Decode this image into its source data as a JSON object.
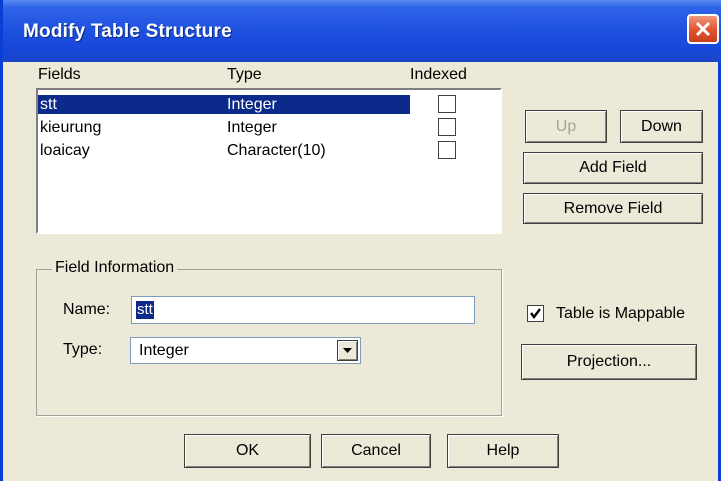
{
  "window": {
    "title": "Modify Table Structure",
    "close_icon": "close-icon"
  },
  "columns": {
    "fields": "Fields",
    "type": "Type",
    "indexed": "Indexed"
  },
  "fields": [
    {
      "name": "stt",
      "type": "Integer",
      "indexed": false,
      "selected": true
    },
    {
      "name": "kieurung",
      "type": "Integer",
      "indexed": false,
      "selected": false
    },
    {
      "name": "loaicay",
      "type": "Character(10)",
      "indexed": false,
      "selected": false
    }
  ],
  "buttons": {
    "up": "Up",
    "down": "Down",
    "add_field": "Add Field",
    "remove_field": "Remove Field",
    "projection": "Projection...",
    "ok": "OK",
    "cancel": "Cancel",
    "help": "Help"
  },
  "field_info": {
    "legend": "Field Information",
    "name_label": "Name:",
    "name_value": "stt",
    "type_label": "Type:",
    "type_value": "Integer"
  },
  "table_mappable": {
    "label": "Table is Mappable",
    "checked": true
  },
  "colors": {
    "titlebar": "#1f52e0",
    "selection": "#0b2a8a",
    "dialog_bg": "#ece9d8",
    "close_button": "#e0522c"
  }
}
